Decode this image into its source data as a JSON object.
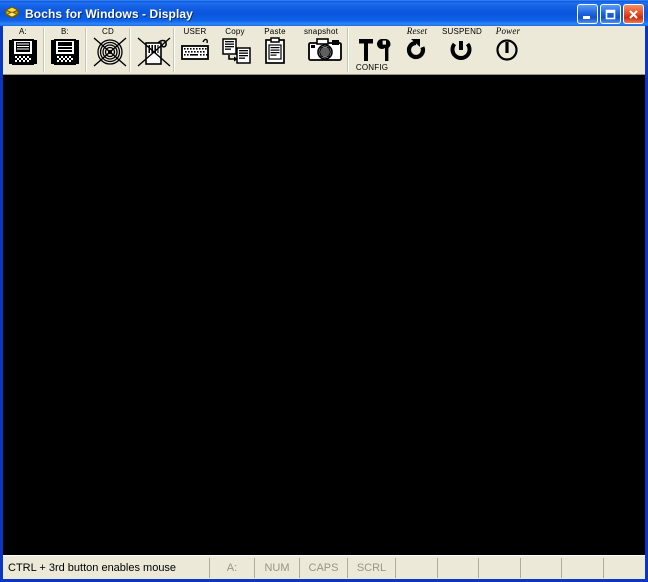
{
  "window": {
    "title": "Bochs for Windows - Display",
    "icon": "bochs-cube-icon",
    "title_bar_color": "#0a55dc",
    "frame_color": "#0a36c4",
    "client_bg": "#ece9d8"
  },
  "window_buttons": [
    {
      "name": "minimize",
      "label": "_",
      "icon": "minimize-icon",
      "color": "#1e66e0"
    },
    {
      "name": "maximize",
      "label": "□",
      "icon": "maximize-icon",
      "color": "#1e66e0"
    },
    {
      "name": "close",
      "label": "✕",
      "icon": "close-icon",
      "color": "#e8502a"
    }
  ],
  "toolbar": {
    "items": [
      {
        "name": "floppy-a",
        "label": "A:",
        "icon": "floppy-disk-icon",
        "label_position": "above",
        "disabled": false
      },
      {
        "name": "floppy-b",
        "label": "B:",
        "icon": "floppy-disk-icon",
        "label_position": "above",
        "disabled": false
      },
      {
        "name": "cdrom",
        "label": "CD",
        "icon": "cdrom-icon",
        "label_position": "above",
        "disabled": true
      },
      {
        "name": "usb-device",
        "label": "",
        "icon": "usb-device-icon",
        "label_position": "above",
        "disabled": true
      },
      {
        "name": "user-button",
        "label": "USER",
        "icon": "keyboard-icon",
        "label_position": "above",
        "disabled": false
      },
      {
        "name": "copy-button",
        "label": "Copy",
        "icon": "copy-icon",
        "label_position": "above",
        "disabled": false
      },
      {
        "name": "paste-button",
        "label": "Paste",
        "icon": "clipboard-icon",
        "label_position": "above",
        "disabled": false
      },
      {
        "name": "snapshot-button",
        "label": "snapshot",
        "icon": "camera-icon",
        "label_position": "above",
        "disabled": false
      },
      {
        "name": "config-button",
        "label": "CONFIG",
        "icon": "tools-icon",
        "label_position": "below",
        "disabled": false
      },
      {
        "name": "reset-button",
        "label": "Reset",
        "icon": "reset-arrow-icon",
        "label_position": "above",
        "disabled": false
      },
      {
        "name": "suspend-button",
        "label": "SUSPEND",
        "icon": "power-suspend-icon",
        "label_position": "above",
        "disabled": false
      },
      {
        "name": "power-button",
        "label": "Power",
        "icon": "power-icon",
        "label_position": "above",
        "disabled": false
      }
    ]
  },
  "display": {
    "name": "vga-display-area",
    "background": "#000000",
    "content": ""
  },
  "statusbar": {
    "message": "CTRL + 3rd button enables mouse",
    "indicators": [
      {
        "name": "floppy-a-indicator",
        "label": "A:",
        "active": false
      },
      {
        "name": "num-lock-indicator",
        "label": "NUM",
        "active": false
      },
      {
        "name": "caps-lock-indicator",
        "label": "CAPS",
        "active": false
      },
      {
        "name": "scroll-lock-indicator",
        "label": "SCRL",
        "active": false
      }
    ],
    "blank_cells": 6
  }
}
